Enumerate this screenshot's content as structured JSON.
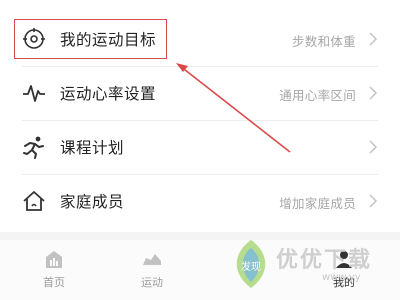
{
  "settings": {
    "items": [
      {
        "label": "我的运动目标",
        "value": "步数和体重",
        "icon": "target-icon"
      },
      {
        "label": "运动心率设置",
        "value": "通用心率区间",
        "icon": "heart-rate-icon"
      },
      {
        "label": "课程计划",
        "value": "",
        "icon": "running-person-icon"
      },
      {
        "label": "家庭成员",
        "value": "增加家庭成员",
        "icon": "home-icon"
      }
    ]
  },
  "tabbar": {
    "tabs": [
      {
        "label": "首页",
        "icon": "home-chart-icon",
        "active": false
      },
      {
        "label": "运动",
        "icon": "shoe-icon",
        "active": false
      },
      {
        "label": "",
        "icon": "discover-icon",
        "active": false
      },
      {
        "label": "我的",
        "icon": "user-icon",
        "active": true
      }
    ]
  },
  "watermark": {
    "text": "优优下载",
    "sub": "www.yy",
    "badge": "发现"
  },
  "annotation": {
    "color": "#d94a4a",
    "target": "我的运动目标"
  }
}
